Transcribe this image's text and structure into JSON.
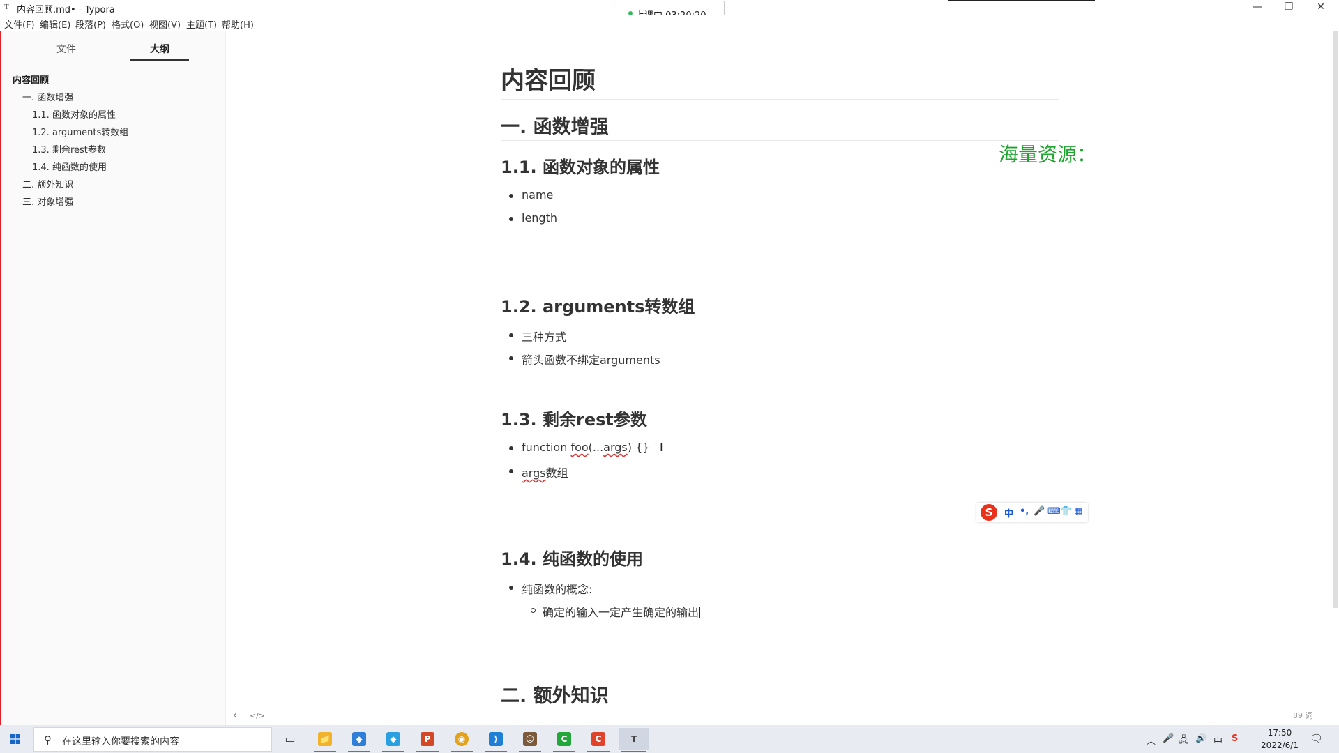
{
  "window": {
    "title": "内容回顾.md• - Typora",
    "app_icon": "T",
    "minimize_icon": "—",
    "restore_icon": "❐",
    "close_icon": "✕"
  },
  "class_widget": {
    "status": "上课中 03:20:20",
    "collapse_icon": "︿"
  },
  "menu": [
    "文件(F)",
    "编辑(E)",
    "段落(P)",
    "格式(O)",
    "视图(V)",
    "主题(T)",
    "帮助(H)"
  ],
  "sidebar": {
    "tabs": [
      "文件",
      "大纲"
    ],
    "active_tab": "大纲",
    "outline": [
      {
        "label": "内容回顾",
        "level": 0
      },
      {
        "label": "一. 函数增强",
        "level": 1
      },
      {
        "label": "1.1. 函数对象的属性",
        "level": 2
      },
      {
        "label": "1.2. arguments转数组",
        "level": 2
      },
      {
        "label": "1.3. 剩余rest参数",
        "level": 2
      },
      {
        "label": "1.4. 纯函数的使用",
        "level": 2
      },
      {
        "label": "二. 额外知识",
        "level": 1
      },
      {
        "label": "三. 对象增强",
        "level": 1
      }
    ]
  },
  "document": {
    "title": "内容回顾",
    "section1": "一. 函数增强",
    "s1_1": {
      "heading": "1.1. 函数对象的属性",
      "items": [
        "name",
        "length"
      ]
    },
    "s1_2": {
      "heading": "1.2. arguments转数组",
      "items": [
        "三种方式",
        "箭头函数不绑定arguments"
      ]
    },
    "s1_3": {
      "heading": "1.3. 剩余rest参数",
      "item1_prefix": "function ",
      "item1_foo": "foo",
      "item1_mid": "(...",
      "item1_args": "args",
      "item1_suffix": ") {}",
      "item2_args": "args",
      "item2_suffix": "数组"
    },
    "s1_4": {
      "heading": "1.4. 纯函数的使用",
      "item": "纯函数的概念:",
      "sub_item": "确定的输入一定产生确定的输出"
    },
    "section2": "二. 额外知识"
  },
  "watermark": "海量资源：",
  "ime": {
    "logo": "S",
    "items": [
      "中",
      "•,",
      "🎤",
      "⌨",
      "👕",
      "▦"
    ]
  },
  "footer": {
    "back_icon": "‹",
    "source_icon": "</>",
    "word_count": "89 词"
  },
  "taskbar": {
    "search_placeholder": "在这里输入你要搜索的内容",
    "search_icon": "⚲",
    "clock_time": "17:50",
    "clock_date": "2022/6/1",
    "tray_up": "︿",
    "tray_mic": "🎤",
    "tray_network": "🖧",
    "tray_volume": "🔊",
    "tray_ime": "中",
    "tray_sogou": "S",
    "notification_icon": "🗨",
    "apps": [
      {
        "name": "task-view",
        "glyph": "▭",
        "color": "#333333"
      },
      {
        "name": "file-explorer",
        "glyph": "📁",
        "color": "#f2b22a"
      },
      {
        "name": "app-blue-1",
        "glyph": "◆",
        "color": "#2f7fd9"
      },
      {
        "name": "app-blue-2",
        "glyph": "◆",
        "color": "#2aa0e0"
      },
      {
        "name": "powerpoint",
        "glyph": "P",
        "color": "#d24726"
      },
      {
        "name": "chrome",
        "glyph": "◉",
        "color": "#e3a21a"
      },
      {
        "name": "vscode",
        "glyph": "⟩",
        "color": "#1f7fd4"
      },
      {
        "name": "avatar-app",
        "glyph": "☺",
        "color": "#7a5a3a"
      },
      {
        "name": "app-green",
        "glyph": "C",
        "color": "#22a73a"
      },
      {
        "name": "app-red",
        "glyph": "C",
        "color": "#e0432a"
      },
      {
        "name": "typora",
        "glyph": "T",
        "color": "#444444"
      }
    ]
  }
}
